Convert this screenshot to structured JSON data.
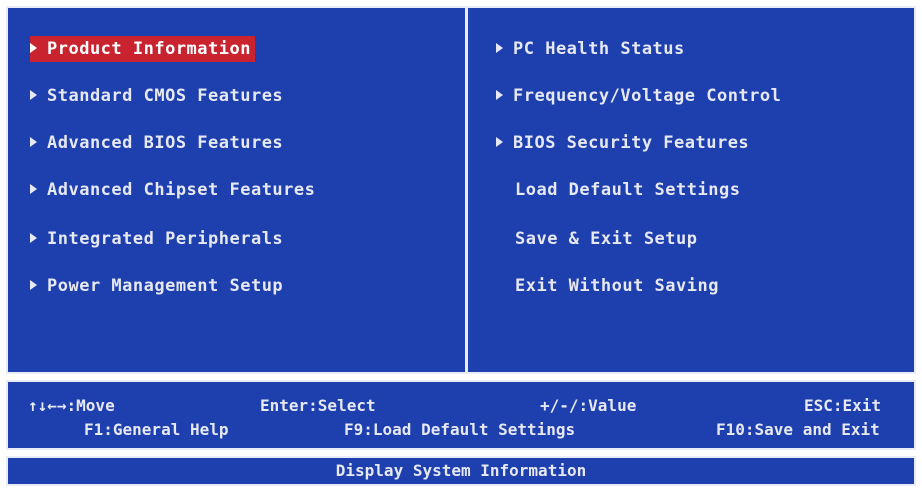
{
  "left_menu": [
    {
      "label": "Product Information",
      "has_arrow": true,
      "selected": true
    },
    {
      "label": "Standard CMOS Features",
      "has_arrow": true,
      "selected": false
    },
    {
      "label": "Advanced BIOS Features",
      "has_arrow": true,
      "selected": false
    },
    {
      "label": "Advanced Chipset Features",
      "has_arrow": true,
      "selected": false
    },
    {
      "label": "Integrated Peripherals",
      "has_arrow": true,
      "selected": false
    },
    {
      "label": "Power Management Setup",
      "has_arrow": true,
      "selected": false
    }
  ],
  "right_menu": [
    {
      "label": "PC Health Status",
      "has_arrow": true
    },
    {
      "label": "Frequency/Voltage Control",
      "has_arrow": true
    },
    {
      "label": "BIOS Security Features",
      "has_arrow": true
    },
    {
      "label": "Load Default Settings",
      "has_arrow": false
    },
    {
      "label": "Save & Exit Setup",
      "has_arrow": false
    },
    {
      "label": "Exit Without Saving",
      "has_arrow": false
    }
  ],
  "key_help": {
    "move": "↑↓←→:Move",
    "select": "Enter:Select",
    "value": "+/-/:Value",
    "exit": "ESC:Exit",
    "general_help": "F1:General Help",
    "load_defaults": "F9:Load Default Settings",
    "save_exit": "F10:Save and Exit"
  },
  "status_bar": "Display System Information",
  "colors": {
    "background": "#1e3fae",
    "text": "#e6e8f2",
    "highlight": "#c8232f",
    "border": "#e9ecf6"
  }
}
